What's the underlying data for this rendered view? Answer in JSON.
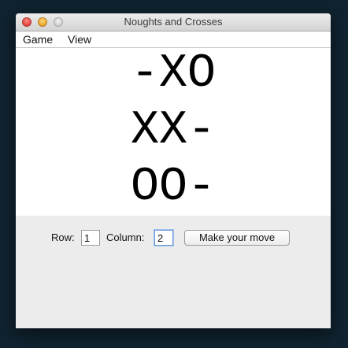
{
  "window": {
    "title": "Noughts and Crosses"
  },
  "menu": {
    "items": [
      {
        "label": "Game"
      },
      {
        "label": "View"
      }
    ]
  },
  "board": {
    "rows": [
      "-XO",
      "XX-",
      "OO-"
    ]
  },
  "controls": {
    "row_label": "Row:",
    "row_value": "1",
    "column_label": "Column:",
    "column_value": "2",
    "move_button_label": "Make your move"
  }
}
